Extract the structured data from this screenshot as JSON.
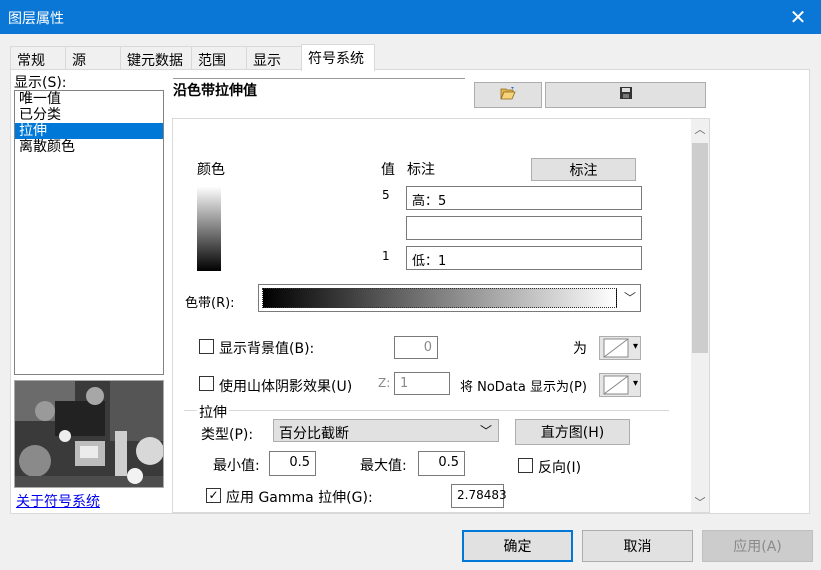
{
  "window": {
    "title": "图层属性",
    "close_glyph": "✕"
  },
  "tabs": [
    {
      "label": "常规"
    },
    {
      "label": "源"
    },
    {
      "label": "键元数据"
    },
    {
      "label": "范围"
    },
    {
      "label": "显示"
    },
    {
      "label": "符号系统",
      "active": true
    }
  ],
  "left": {
    "show_label": "显示(S):",
    "list_items": [
      "唯一值",
      "已分类",
      "拉伸",
      "离散颜色"
    ],
    "selected_index": 2,
    "link_text": "关于符号系统"
  },
  "main": {
    "heading": "沿色带拉伸值",
    "open_icon": "folder-open-icon",
    "save_icon": "save-icon",
    "color_label": "颜色",
    "value_label": "值",
    "annotation_label": "标注",
    "annotation_button": "标注",
    "high_value": "5",
    "high_label": "高：5",
    "mid_label": "",
    "low_value": "1",
    "low_label": "低：1",
    "colorramp_label": "色带(R):",
    "show_background_label": "显示背景值(B):",
    "background_value": "0",
    "as_label": "为",
    "hillshade_label": "使用山体阴影效果(U)",
    "z_label": "Z:",
    "z_value": "1",
    "nodata_label": "将 NoData 显示为(P)"
  },
  "stretch": {
    "group_label": "拉伸",
    "type_label": "类型(P):",
    "type_value": "百分比截断",
    "histogram_button": "直方图(H)",
    "min_label": "最小值:",
    "min_value": "0.5",
    "max_label": "最大值:",
    "max_value": "0.5",
    "invert_label": "反向(I)",
    "gamma_label": "应用 Gamma 拉伸(G):",
    "gamma_checked": true,
    "gamma_value": "2.78483"
  },
  "buttons": {
    "ok": "确定",
    "cancel": "取消",
    "apply": "应用(A)"
  },
  "colors": {
    "titlebar": "#0a76d5",
    "selection": "#0078d7",
    "ok_border": "#0078d7"
  }
}
